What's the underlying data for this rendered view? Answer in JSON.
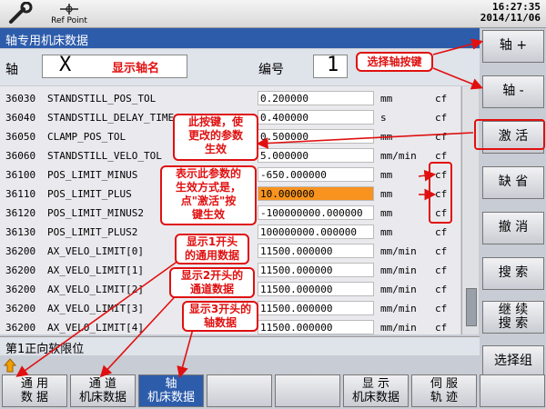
{
  "topbar": {
    "tool_icon": "wrench-icon",
    "ref_point_label": "Ref Point",
    "time": "16:27:35",
    "date": "2014/11/06"
  },
  "title": "轴专用机床数据",
  "header": {
    "axis_label": "轴",
    "axis_value": "X",
    "axis_name_note": "显示轴名",
    "number_label": "编号",
    "number_value": "1"
  },
  "rows": [
    {
      "id": "36030",
      "name": "STANDSTILL_POS_TOL",
      "value": "0.200000",
      "unit": "mm",
      "effect": "cf"
    },
    {
      "id": "36040",
      "name": "STANDSTILL_DELAY_TIME",
      "value": "0.400000",
      "unit": "s",
      "effect": "cf"
    },
    {
      "id": "36050",
      "name": "CLAMP_POS_TOL",
      "value": "0.500000",
      "unit": "mm",
      "effect": "cf"
    },
    {
      "id": "36060",
      "name": "STANDSTILL_VELO_TOL",
      "value": "5.000000",
      "unit": "mm/min",
      "effect": "cf"
    },
    {
      "id": "36100",
      "name": "POS_LIMIT_MINUS",
      "value": "-650.000000",
      "unit": "mm",
      "effect": "cf"
    },
    {
      "id": "36110",
      "name": "POS_LIMIT_PLUS",
      "value": "10.000000",
      "unit": "mm",
      "effect": "cf"
    },
    {
      "id": "36120",
      "name": "POS_LIMIT_MINUS2",
      "value": "-100000000.000000",
      "unit": "mm",
      "effect": "cf"
    },
    {
      "id": "36130",
      "name": "POS_LIMIT_PLUS2",
      "value": "100000000.000000",
      "unit": "mm",
      "effect": "cf"
    },
    {
      "id": "36200",
      "name": "AX_VELO_LIMIT[0]",
      "value": "11500.000000",
      "unit": "mm/min",
      "effect": "cf"
    },
    {
      "id": "36200",
      "name": "AX_VELO_LIMIT[1]",
      "value": "11500.000000",
      "unit": "mm/min",
      "effect": "cf"
    },
    {
      "id": "36200",
      "name": "AX_VELO_LIMIT[2]",
      "value": "11500.000000",
      "unit": "mm/min",
      "effect": "cf"
    },
    {
      "id": "36200",
      "name": "AX_VELO_LIMIT[3]",
      "value": "11500.000000",
      "unit": "mm/min",
      "effect": "cf"
    },
    {
      "id": "36200",
      "name": "AX_VELO_LIMIT[4]",
      "value": "11500.000000",
      "unit": "mm/min",
      "effect": "cf"
    }
  ],
  "selected_row": 5,
  "status_text": "第1正向软限位",
  "side_buttons": [
    {
      "label": "轴 +"
    },
    {
      "label": "轴 -"
    },
    {
      "label": "激 活"
    },
    {
      "label": "缺 省"
    },
    {
      "label": "撤 消"
    },
    {
      "label": "搜 索"
    },
    {
      "label": "继 续\n搜 索"
    },
    {
      "label": "选择组"
    }
  ],
  "bottom_buttons": [
    {
      "label": "通  用\n数  据"
    },
    {
      "label": "通    道\n机床数据"
    },
    {
      "label": "轴\n机床数据"
    },
    {
      "label": ""
    },
    {
      "label": ""
    },
    {
      "label": "显    示\n机床数据"
    },
    {
      "label": "伺  服\n轨  迹"
    },
    {
      "label": ""
    }
  ],
  "annotations": {
    "select_axis": "选择轴按键",
    "activate": "此按键，使\n更改的参数\n生效",
    "effect_mode": "表示此参数的\n生效方式是，\n点\"激活\"按\n键生效",
    "general": "显示1开头\n的通用数据",
    "channel": "显示2开头的\n通道数据",
    "axis": "显示3开头的\n轴数据"
  },
  "colors": {
    "title_bg": "#2d5cab",
    "highlight": "#f7931e",
    "annotation": "#e01010"
  }
}
